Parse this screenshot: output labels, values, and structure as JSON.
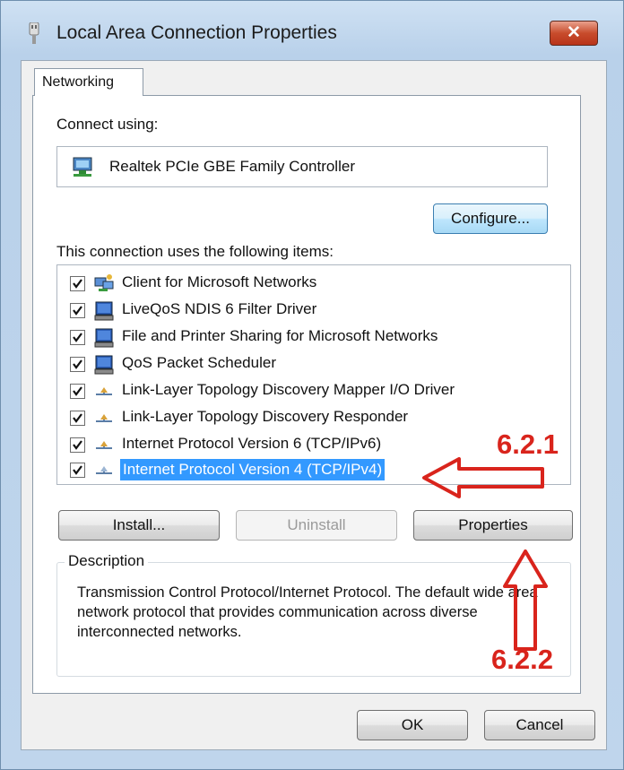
{
  "window": {
    "title": "Local Area Connection Properties",
    "close_glyph": "✕"
  },
  "tabs": [
    "Networking"
  ],
  "connect_using": {
    "label": "Connect using:",
    "adapter": "Realtek PCIe GBE Family Controller",
    "configure_label": "Configure..."
  },
  "items_label": "This connection uses the following items:",
  "items": [
    {
      "label": "Client for Microsoft Networks",
      "checked": true,
      "icon": "network-client-icon"
    },
    {
      "label": "LiveQoS NDIS 6 Filter Driver",
      "checked": true,
      "icon": "service-icon"
    },
    {
      "label": "File and Printer Sharing for Microsoft Networks",
      "checked": true,
      "icon": "service-icon"
    },
    {
      "label": "QoS Packet Scheduler",
      "checked": true,
      "icon": "service-icon"
    },
    {
      "label": "Link-Layer Topology Discovery Mapper I/O Driver",
      "checked": true,
      "icon": "protocol-icon"
    },
    {
      "label": "Link-Layer Topology Discovery Responder",
      "checked": true,
      "icon": "protocol-icon"
    },
    {
      "label": "Internet Protocol Version 6 (TCP/IPv6)",
      "checked": true,
      "icon": "protocol-icon"
    },
    {
      "label": "Internet Protocol Version 4 (TCP/IPv4)",
      "checked": true,
      "icon": "protocol-icon",
      "selected": true
    }
  ],
  "buttons": {
    "install": "Install...",
    "uninstall": "Uninstall",
    "properties": "Properties",
    "ok": "OK",
    "cancel": "Cancel"
  },
  "description": {
    "legend": "Description",
    "text": "Transmission Control Protocol/Internet Protocol. The default wide area network protocol that provides communication across diverse interconnected networks."
  },
  "annotations": {
    "step1": "6.2.1",
    "step2": "6.2.2",
    "color": "#d9241c"
  },
  "colors": {
    "selection": "#3399ff",
    "title_bar": "#b9d1ea"
  }
}
